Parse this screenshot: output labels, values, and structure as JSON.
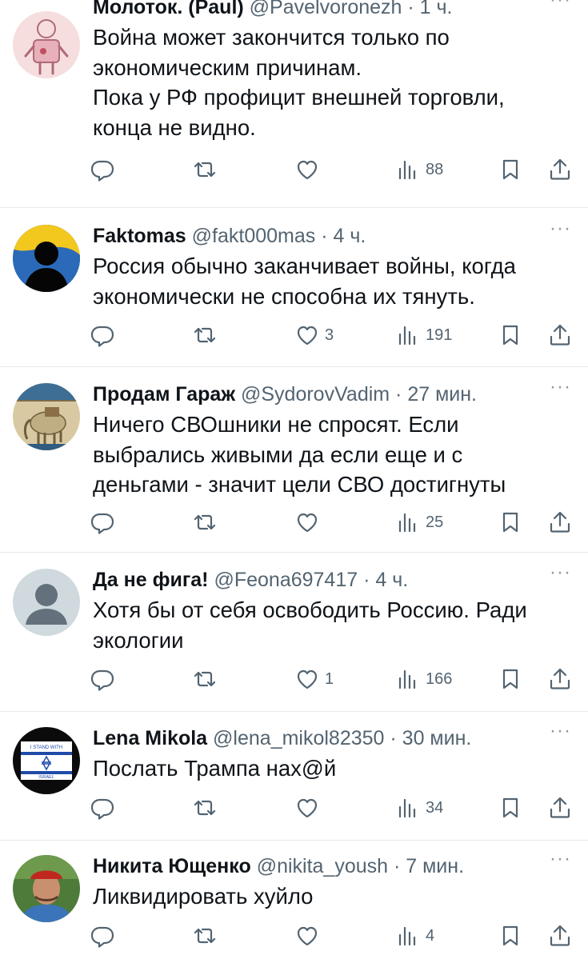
{
  "tweets": [
    {
      "name": "Молоток. (Paul)",
      "handle": "@Pavelvoronezh",
      "time": "1 ч.",
      "text": "Война может закончится только по\nэкономическим причинам.\nПока у РФ профицит внешней торговли,\nконца не видно.",
      "likes": "",
      "views": "88",
      "avatar": "robot-avatar"
    },
    {
      "name": "Faktomas",
      "handle": "@fakt000mas",
      "time": "4 ч.",
      "text": "Россия обычно заканчивает войны, когда\nэкономически не способна их тянуть.",
      "likes": "3",
      "views": "191",
      "avatar": "silhouette-avatar"
    },
    {
      "name": "Продам Гараж",
      "handle": "@SydorovVadim",
      "time": "27 мин.",
      "text": "Ничего СВОшники не спросят. Если\nвыбрались живыми да если еще и с\nденьгами - значит цели СВО достигнуты",
      "likes": "",
      "views": "25",
      "avatar": "elephant-painting-avatar"
    },
    {
      "name": "Да не фига!",
      "handle": "@Feona697417",
      "time": "4 ч.",
      "text": "Хотя бы от себя освободить Россию. Ради\nэкологии",
      "likes": "1",
      "views": "166",
      "avatar": "default-avatar"
    },
    {
      "name": "Lena Mikola",
      "handle": "@lena_mikol82350",
      "time": "30 мин.",
      "text": "Послать Трампа нах@й",
      "likes": "",
      "views": "34",
      "avatar": "i-stand-with-israel-avatar",
      "avatar_text": [
        "I STAND WITH",
        "ISRAEL"
      ]
    },
    {
      "name": "Никита Ющенко",
      "handle": "@nikita_yoush",
      "time": "7 мин.",
      "text": "Ликвидировать хуйло",
      "likes": "",
      "views": "4",
      "avatar": "man-in-cap-avatar"
    }
  ],
  "icons": {
    "reply": "reply-icon",
    "retweet": "retweet-icon",
    "like": "heart-icon",
    "views": "views-icon",
    "bookmark": "bookmark-icon",
    "share": "share-icon",
    "more": "more-icon"
  },
  "colors": {
    "text": "#0f1419",
    "secondary": "#536471",
    "separator": "#e7e9ea",
    "israel_blue": "#1f4aa8"
  }
}
